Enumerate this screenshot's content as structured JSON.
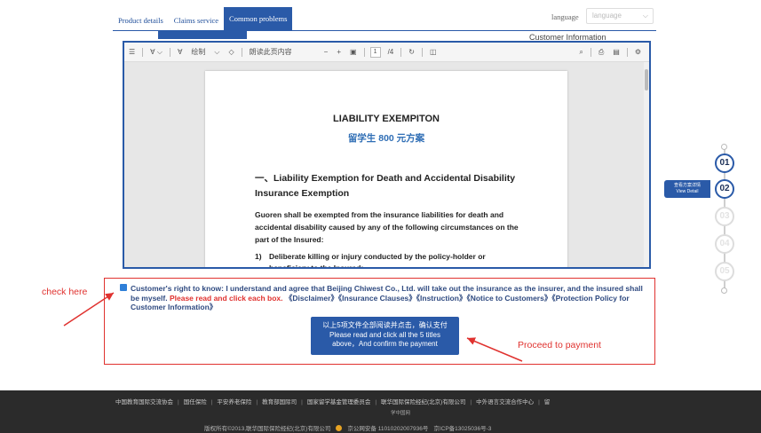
{
  "tabs": [
    {
      "label": "Product details"
    },
    {
      "label": "Claims service"
    },
    {
      "label": "Common problems"
    }
  ],
  "language": {
    "label": "language",
    "select_value": "language"
  },
  "customer_info": "Customer Information",
  "toolbar": {
    "draw_label": "绘制",
    "read_aloud_label": "朗读此页内容",
    "page_current": "1",
    "page_total": "/4"
  },
  "document": {
    "title": "LIABILITY EXEMPITON",
    "subtitle": "留学生 800 元方案",
    "heading": "一、Liability Exemption for Death and Accidental Disability Insurance Exemption",
    "paragraph": "Guoren shall be exempted from the insurance liabilities for death and accidental disability caused by any of the following circumstances on the part of the Insured:",
    "list_item_num": "1)",
    "list_item": "Deliberate killing or injury conducted by the policy-holder or beneficiary to the Insured;"
  },
  "agreement": {
    "text": "Customer's right to know: I understand and agree that Beijing Chiwest Co., Ltd. will take out the insurance as the insurer, and the insured shall be myself.",
    "emphasis": "Please read and click each box.",
    "docs": [
      "《Disclaimer》",
      "《Insurance Clauses》",
      "《Instruction》",
      "《Notice to Customers》",
      "《Protection Policy for Customer Information》"
    ]
  },
  "pay_button": {
    "line1": "以上5项文件全部阅读并点击，确认支付",
    "line2": "Please read and click all the 5 titles",
    "line3": "above，And confirm the payment"
  },
  "annotations": {
    "check_here": "check here",
    "proceed": "Proceed to payment"
  },
  "steps": {
    "items": [
      "01",
      "02",
      "03",
      "04",
      "05"
    ],
    "current_tag_cn": "查看方案详情",
    "current_tag_en": "View Detail"
  },
  "footer": {
    "links": [
      "中国教育国际交流协会",
      "国任保险",
      "平安养老保险",
      "教育部国际司",
      "国家留学基金管理委员会",
      "联华国际保险经纪(北京)有限公司",
      "中外语言交流合作中心",
      "留"
    ],
    "sub": "学中国网",
    "copyright": "版权所有©2013,联华国际保险经纪(北京)有限公司",
    "police": "京公网安备 11010202007936号",
    "icp": "京ICP备13025036号-3"
  },
  "colors": {
    "brand": "#2a5aa8",
    "alert": "#e0322f",
    "footer_bg": "#2b2b2b"
  }
}
